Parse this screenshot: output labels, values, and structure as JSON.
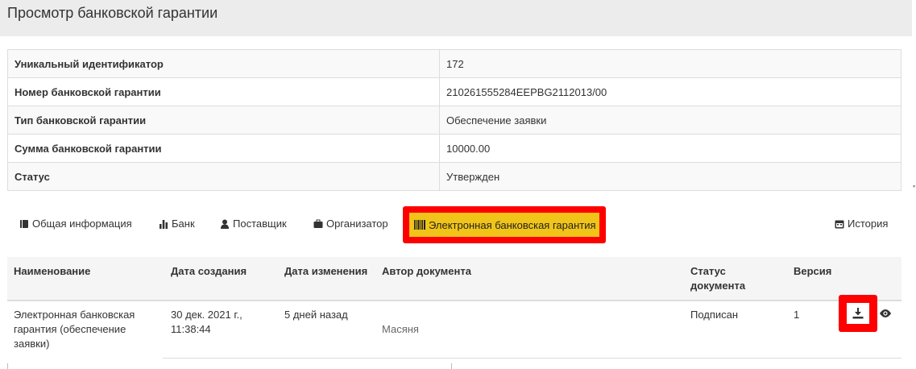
{
  "page": {
    "title": "Просмотр банковской гарантии"
  },
  "info": [
    {
      "label": "Уникальный идентификатор",
      "value": "172"
    },
    {
      "label": "Номер банковской гарантии",
      "value": "210261555284EEPBG2112013/00"
    },
    {
      "label": "Тип банковской гарантии",
      "value": "Обеспечение заявки"
    },
    {
      "label": "Сумма банковской гарантии",
      "value": "10000.00"
    },
    {
      "label": "Статус",
      "value": "Утвержден"
    }
  ],
  "tabs": {
    "general": {
      "label": "Общая информация",
      "icon": "book-icon"
    },
    "bank": {
      "label": "Банк",
      "icon": "bar-chart-icon"
    },
    "supplier": {
      "label": "Поставщик",
      "icon": "user-icon"
    },
    "organizer": {
      "label": "Организатор",
      "icon": "briefcase-icon"
    },
    "eguarantee": {
      "label": "Электронная банковская гарантия",
      "icon": "barcode-icon",
      "active": true
    },
    "history": {
      "label": "История",
      "icon": "calendar-icon"
    }
  },
  "documents": {
    "headers": {
      "name": "Наименование",
      "created": "Дата создания",
      "modified": "Дата изменения",
      "author": "Автор документа",
      "status_line1": "Статус",
      "status_line2": "документа",
      "version": "Версия"
    },
    "rows": [
      {
        "name_lines": [
          "Электронная банковская",
          "гарантия (обеспечение",
          "заявки)"
        ],
        "created_lines": [
          "30 дек. 2021 г.,",
          "11:38:44"
        ],
        "modified": "5 дней назад",
        "author": "Масяня",
        "status": "Подписан",
        "version": "1",
        "actions": [
          "download-icon",
          "eye-icon"
        ]
      }
    ]
  },
  "colors": {
    "active_tab_bg": "#f0c418",
    "highlight": "#ff0000",
    "header_bg": "#ececec"
  }
}
